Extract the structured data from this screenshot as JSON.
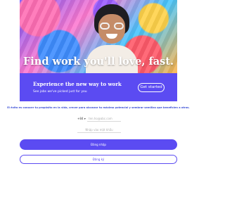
{
  "hero": {
    "headline": "Find work you'll love, fast."
  },
  "promo": {
    "title": "Experience the new way to work",
    "subtitle": "See jobs we've picked just for you",
    "button_label": "Get started"
  },
  "mission": {
    "text": "El éxito es conocer tu propósito en la vida, crecer para alcanzar tu máximo potencial y sembrar semillas que beneficien a otros."
  },
  "form": {
    "country_code": "+84 ▾",
    "email_placeholder": "ten.ho@abc.com",
    "password_placeholder": "Nhập vào mật khẩu"
  },
  "actions": {
    "login_label": "Đăng nhập",
    "register_label": "Đăng ký"
  },
  "colors": {
    "accent": "#5b4bf2",
    "mission_text": "#3b4fd6"
  }
}
